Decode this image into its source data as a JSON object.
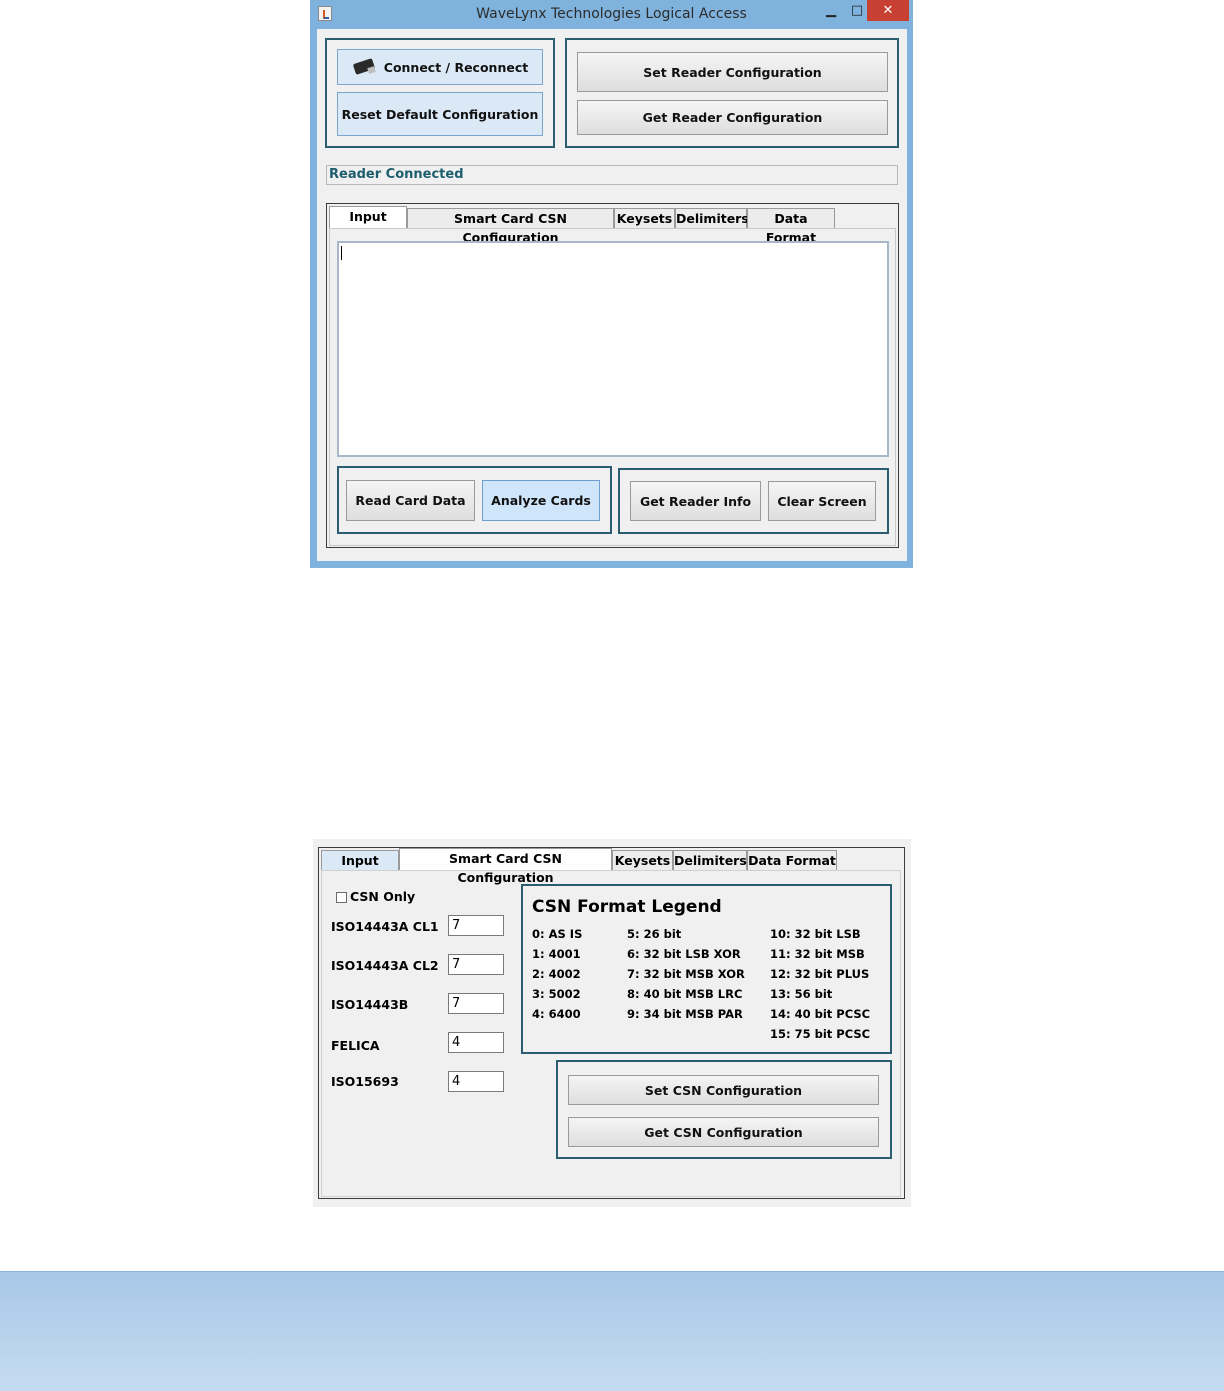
{
  "window": {
    "title": "WaveLynx Technologies Logical Access",
    "controls": {
      "minimize": "▁",
      "maximize": "□",
      "close": "✕"
    }
  },
  "top_buttons": {
    "connect": "Connect / Reconnect",
    "reset": "Reset Default Configuration",
    "set_config": "Set Reader Configuration",
    "get_config": "Get Reader Configuration"
  },
  "status": "Reader Connected",
  "tabs": [
    {
      "label": "Input"
    },
    {
      "label": "Smart Card CSN Configuration"
    },
    {
      "label": "Keysets"
    },
    {
      "label": "Delimiters"
    },
    {
      "label": "Data Format"
    }
  ],
  "input_tab": {
    "text_area_value": "",
    "read_card": "Read Card Data",
    "analyze": "Analyze Cards",
    "get_info": "Get Reader Info",
    "clear": "Clear Screen"
  },
  "csn_tab": {
    "csn_only_label": "CSN Only",
    "csn_only_checked": false,
    "fields": [
      {
        "label": "ISO14443A CL1",
        "value": "7"
      },
      {
        "label": "ISO14443A CL2",
        "value": "7"
      },
      {
        "label": "ISO14443B",
        "value": "7"
      },
      {
        "label": "FELICA",
        "value": "4"
      },
      {
        "label": "ISO15693",
        "value": "4"
      }
    ],
    "legend_title": "CSN Format Legend",
    "legend_col1": [
      "0: AS IS",
      "1: 4001",
      "2: 4002",
      "3: 5002",
      "4: 6400"
    ],
    "legend_col2": [
      "5: 26 bit",
      "6: 32 bit LSB XOR",
      "7: 32 bit MSB XOR",
      "8: 40 bit MSB LRC",
      "9: 34 bit MSB PAR"
    ],
    "legend_col3": [
      "10: 32 bit LSB",
      "11: 32 bit MSB",
      "12: 32 bit PLUS",
      "13: 56 bit",
      "14: 40 bit PCSC",
      "15: 75 bit PCSC"
    ],
    "set_csn": "Set CSN Configuration",
    "get_csn": "Get CSN Configuration"
  },
  "colors": {
    "panel_border": "#2b5d6e",
    "status_text": "#1d5e6e",
    "titlebar": "#7fb2dc",
    "close_button": "#c84031"
  }
}
